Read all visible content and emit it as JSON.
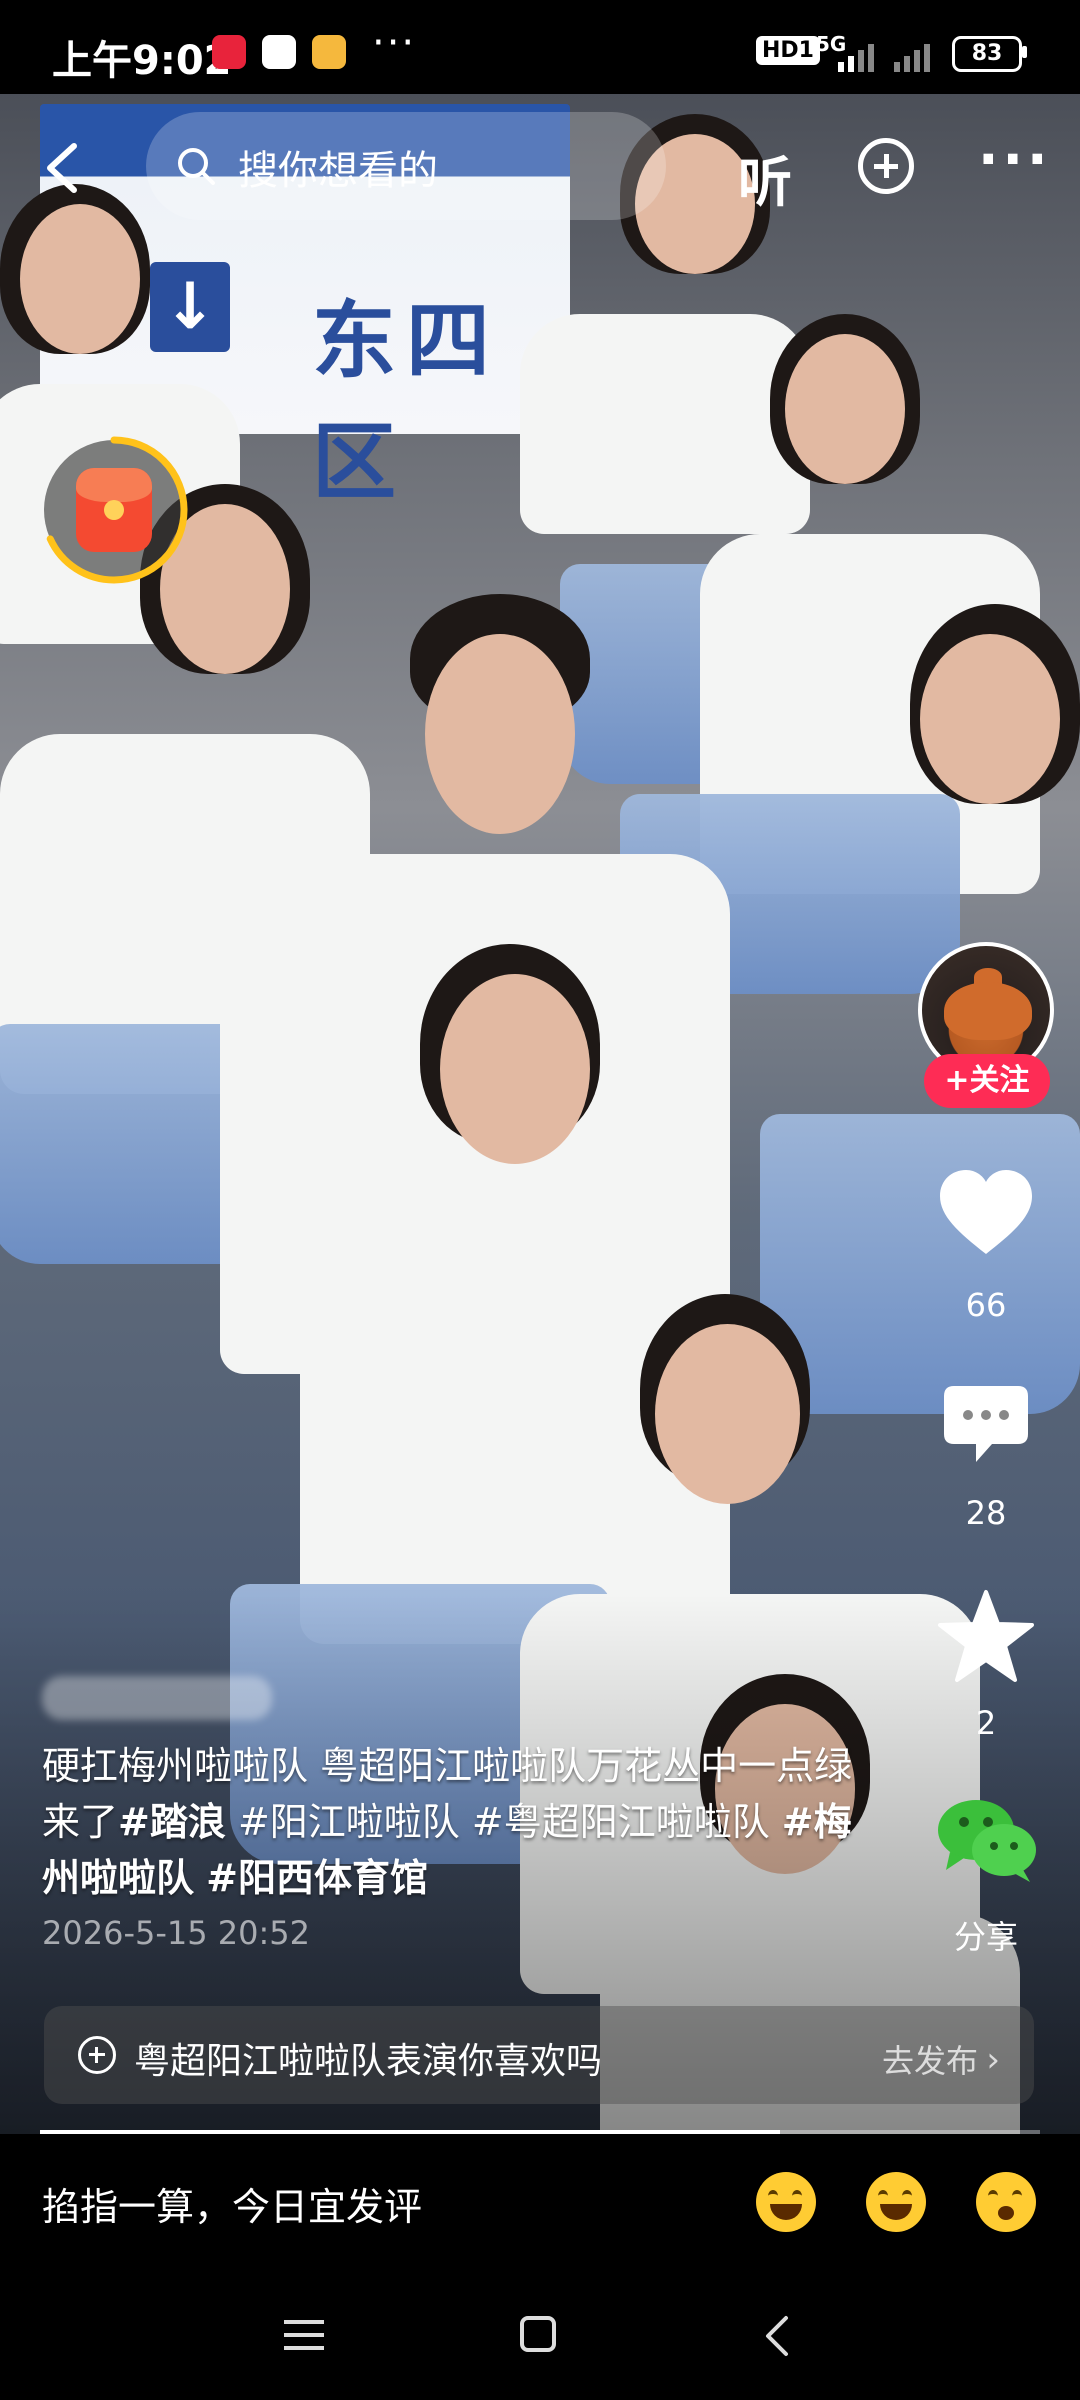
{
  "status_bar": {
    "time": "上午9:02",
    "dots": "···",
    "hd": "HD1",
    "network": "5G",
    "battery": "83"
  },
  "top_bar": {
    "search_placeholder": "搜你想看的",
    "listen_label": "听",
    "more_label": "···"
  },
  "video": {
    "sign_text": "东四区"
  },
  "side_rail": {
    "follow_label": "+关注",
    "like_count": "66",
    "comment_count": "28",
    "favorite_count": "2",
    "share_label": "分享"
  },
  "caption": {
    "text_1": "硬扛梅州啦啦队 粤超阳江啦啦队万花丛中一点绿来了",
    "tag_1": "#踏浪",
    "text_2": " #阳江啦啦队 #粤超阳江啦啦队 ",
    "tag_2": "#梅州啦啦队",
    "text_3": " ",
    "tag_3": "#阳西体育馆",
    "timestamp": "2026-5-15 20:52"
  },
  "prompt_bar": {
    "text": "粤超阳江啦啦队表演你喜欢吗",
    "action": "去发布"
  },
  "progress": {
    "value": 0.74
  },
  "comment_bar": {
    "placeholder": "掐指一算，今日宜发评"
  },
  "colors": {
    "follow_red": "#fe2c55",
    "wechat_green": "#3bbf3b",
    "emoji_yellow": "#ffcc33"
  },
  "icons": [
    "back-icon",
    "search-icon",
    "plus-icon",
    "more-icon",
    "red-packet-icon",
    "heart-icon",
    "comment-icon",
    "star-icon",
    "wechat-share-icon",
    "menu-icon",
    "home-icon",
    "back-nav-icon"
  ]
}
